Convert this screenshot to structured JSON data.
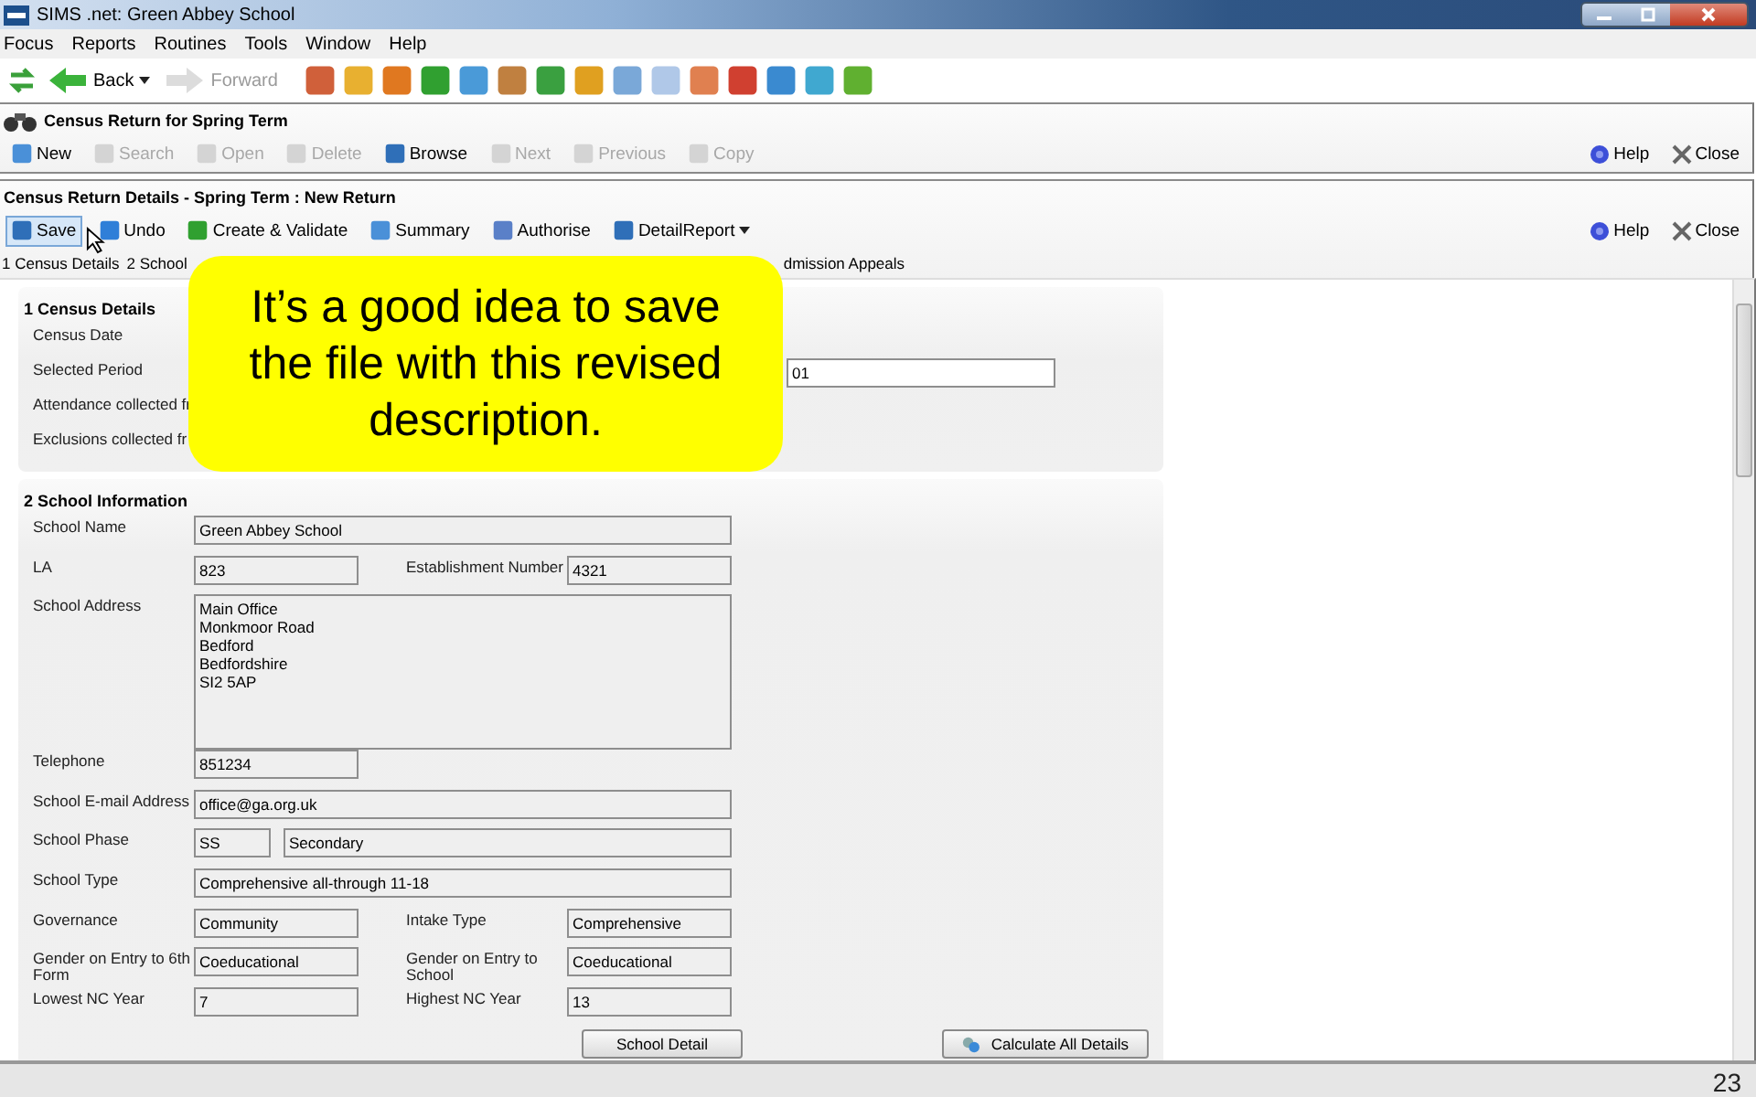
{
  "window": {
    "title": "SIMS .net: Green Abbey School"
  },
  "menu": [
    "Focus",
    "Reports",
    "Routines",
    "Tools",
    "Window",
    "Help"
  ],
  "nav": [
    {
      "label": "Back",
      "disabled": false,
      "dropdown": true
    },
    {
      "label": "Forward",
      "disabled": true,
      "dropdown": false
    }
  ],
  "panel": {
    "title": "Census Return for Spring Term",
    "toolbar": [
      {
        "label": "New",
        "disabled": false
      },
      {
        "label": "Search",
        "disabled": true
      },
      {
        "label": "Open",
        "disabled": true
      },
      {
        "label": "Delete",
        "disabled": true
      },
      {
        "label": "Browse",
        "disabled": false
      },
      {
        "label": "Next",
        "disabled": true
      },
      {
        "label": "Previous",
        "disabled": true
      },
      {
        "label": "Copy",
        "disabled": true
      }
    ],
    "actions": [
      "Help",
      "Close"
    ]
  },
  "detail": {
    "title": "Census Return Details - Spring Term : New Return",
    "toolbar": [
      {
        "label": "Save",
        "selected": true,
        "dropdown": false
      },
      {
        "label": "Undo",
        "selected": false,
        "dropdown": false
      },
      {
        "label": "Create & Validate",
        "selected": false,
        "dropdown": false
      },
      {
        "label": "Summary",
        "selected": false,
        "dropdown": false
      },
      {
        "label": "Authorise",
        "selected": false,
        "dropdown": false
      },
      {
        "label": "DetailReport",
        "selected": false,
        "dropdown": true
      }
    ],
    "actions": [
      "Help",
      "Close"
    ],
    "links": [
      "1 Census Details",
      "2 School",
      "dmission Appeals"
    ]
  },
  "sections": [
    {
      "title": "1 Census Details",
      "rows": [
        {
          "fields": [
            {
              "label": "Census Date",
              "kind": "none"
            }
          ]
        },
        {
          "fields": [
            {
              "label": "Selected Period",
              "kind": "far",
              "value": "01"
            }
          ]
        },
        {
          "fields": [
            {
              "label": "Attendance collected fr",
              "kind": "none"
            }
          ]
        },
        {
          "fields": [
            {
              "label": "Exclusions collected fr",
              "kind": "none"
            }
          ]
        }
      ]
    },
    {
      "title": "2 School Information",
      "rows": [
        {
          "fields": [
            {
              "label": "School Name",
              "kind": "wide",
              "value": "Green Abbey School"
            }
          ]
        },
        {
          "fields": [
            {
              "label": "LA",
              "kind": "short",
              "value": "823"
            },
            {
              "label": "Establishment Number",
              "kind": "short",
              "value": "4321"
            }
          ]
        },
        {
          "fields": [
            {
              "label": "School Address",
              "kind": "multiline",
              "lines": [
                "Main Office",
                "Monkmoor Road",
                "Bedford",
                "Bedfordshire",
                "SI2 5AP"
              ]
            }
          ]
        },
        {
          "fields": [
            {
              "label": "Telephone",
              "kind": "short",
              "value": "851234"
            }
          ]
        },
        {
          "fields": [
            {
              "label": "School E-mail Address",
              "kind": "wide",
              "value": "office@ga.org.uk"
            }
          ]
        },
        {
          "fields": [
            {
              "label": "School Phase",
              "kind": "coded",
              "code": "SS",
              "value": "Secondary"
            }
          ]
        },
        {
          "fields": [
            {
              "label": "School Type",
              "kind": "wide",
              "value": "Comprehensive all-through 11-18"
            }
          ]
        },
        {
          "fields": [
            {
              "label": "Governance",
              "kind": "short",
              "value": "Community"
            },
            {
              "label": "Intake Type",
              "kind": "short",
              "value": "Comprehensive"
            }
          ]
        },
        {
          "fields": [
            {
              "label": "Gender on Entry to 6th Form",
              "kind": "short",
              "value": "Coeducational"
            },
            {
              "label": "Gender on Entry to School",
              "kind": "short",
              "value": "Coeducational"
            }
          ]
        },
        {
          "fields": [
            {
              "label": "Lowest NC Year",
              "kind": "short",
              "value": "7"
            },
            {
              "label": "Highest NC Year",
              "kind": "short",
              "value": "13"
            }
          ]
        }
      ],
      "buttons": [
        "School Detail",
        "Calculate All Details"
      ]
    }
  ],
  "callout": {
    "text": "It’s a good idea to save the file with this revised description."
  },
  "slide_number": "23"
}
